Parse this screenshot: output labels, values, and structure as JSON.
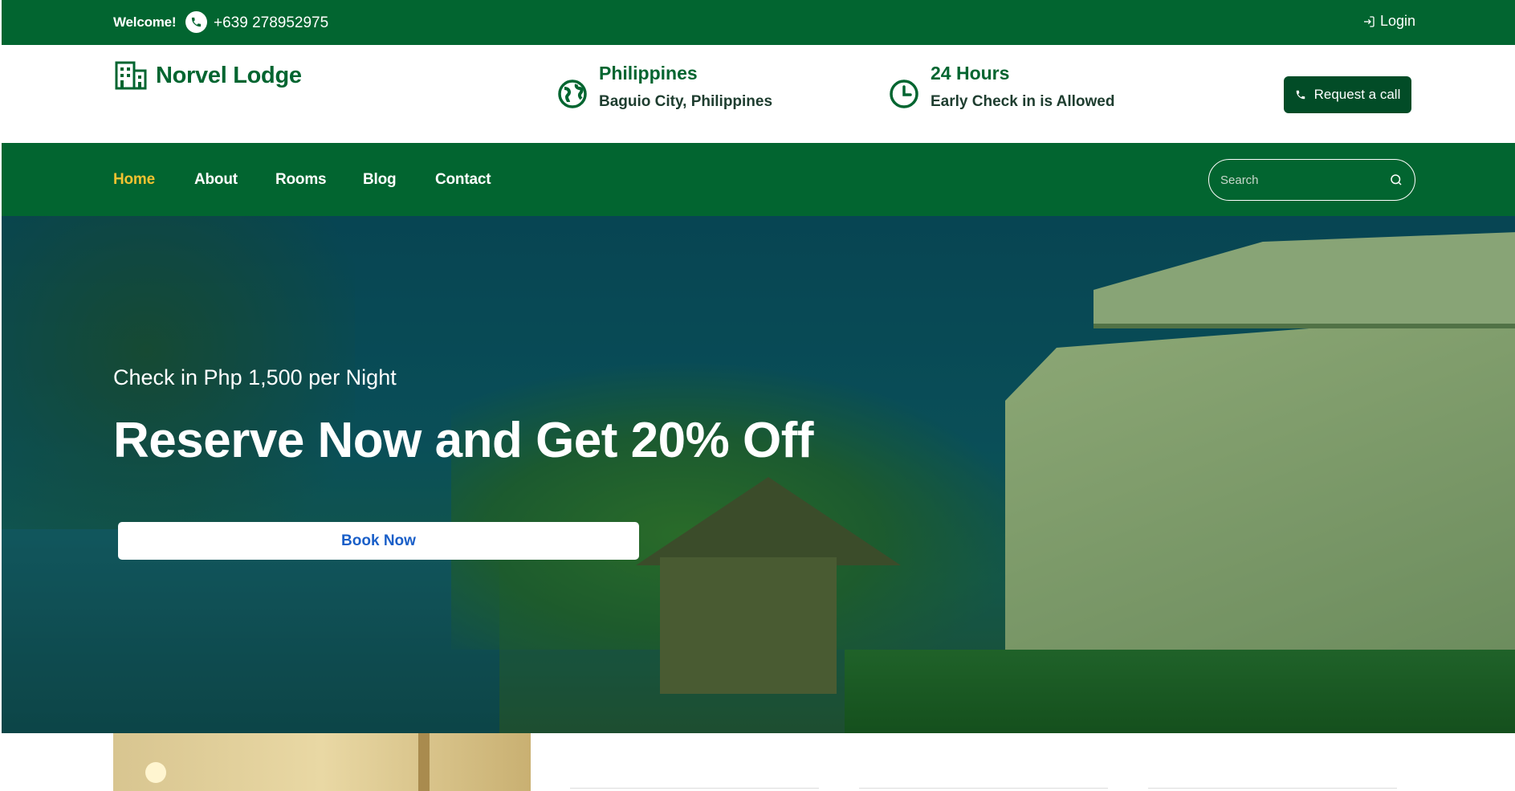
{
  "topbar": {
    "welcome": "Welcome!",
    "phone": "+639 278952975",
    "login": "Login"
  },
  "header": {
    "logo_text": "Norvel Lodge",
    "location_title": "Philippines",
    "location_sub": "Baguio City, Philippines",
    "hours_title": "24 Hours",
    "hours_sub": "Early Check in is Allowed",
    "request_label": "Request a call"
  },
  "nav": {
    "items": [
      {
        "label": "Home",
        "active": true
      },
      {
        "label": "About"
      },
      {
        "label": "Rooms"
      },
      {
        "label": "Blog"
      },
      {
        "label": "Contact"
      }
    ],
    "search_placeholder": "Search"
  },
  "hero": {
    "subtitle": "Check in Php 1,500 per Night",
    "headline": "Reserve Now and Get 20% Off",
    "book_label": "Book Now"
  },
  "colors": {
    "brand_green": "#026530",
    "dark_green": "#024c27",
    "active_nav": "#f2c230",
    "book_text": "#1a5fc8"
  }
}
